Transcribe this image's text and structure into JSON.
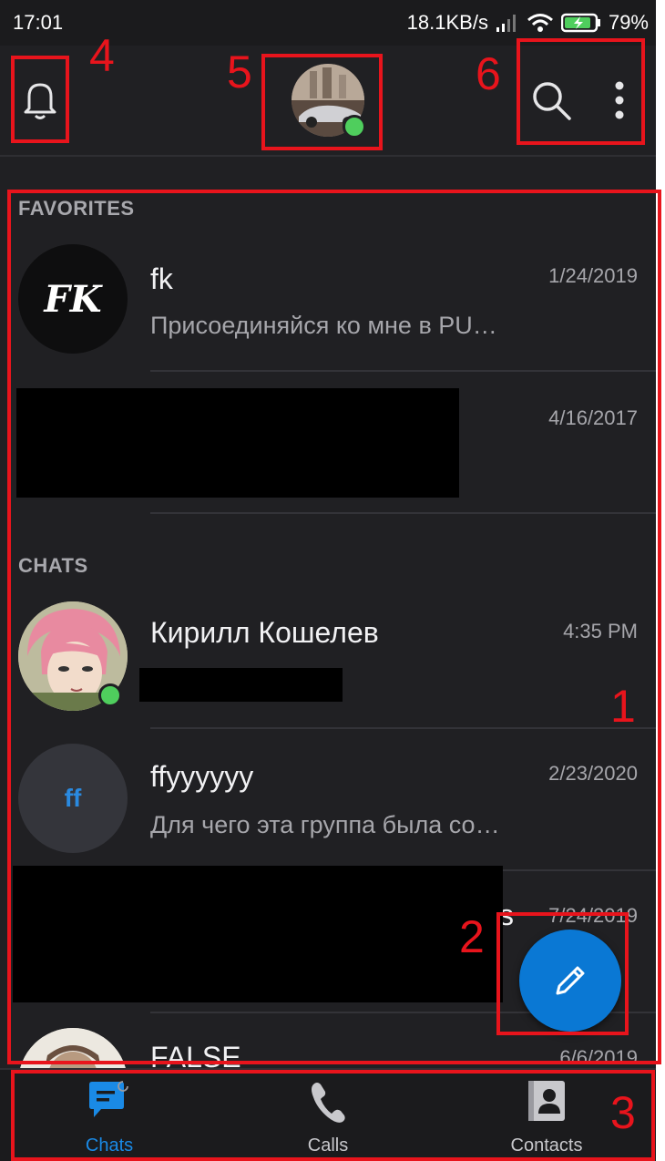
{
  "status_bar": {
    "time": "17:01",
    "net_speed": "18.1KB/s",
    "battery_pct": "79%"
  },
  "app_bar": {
    "notifications_icon": "bell-icon",
    "search_icon": "search-icon",
    "menu_icon": "more-vertical-icon"
  },
  "sections": {
    "favorites": "FAVORITES",
    "chats": "CHATS"
  },
  "favorites": [
    {
      "avatar_text": "FK",
      "name": "fk",
      "preview": "Присоединяйся ко мне в PU…",
      "date": "1/24/2019"
    },
    {
      "name": "",
      "preview": "",
      "date": "4/16/2017"
    }
  ],
  "chats": [
    {
      "name": "Кирилл Кошелев",
      "preview": "",
      "date": "4:35 PM",
      "online": true
    },
    {
      "avatar_text": "ff",
      "name": "ffyyyyyy",
      "preview": "Для чего эта группа была со…",
      "date": "2/23/2020"
    },
    {
      "name": "",
      "name_tail": "s",
      "preview": "",
      "date": "7/24/2019"
    },
    {
      "name": "FALSE",
      "preview": "",
      "date": "6/6/2019"
    }
  ],
  "bottom_nav": [
    {
      "label": "Chats",
      "icon": "chat-icon",
      "active": true
    },
    {
      "label": "Calls",
      "icon": "phone-icon",
      "active": false
    },
    {
      "label": "Contacts",
      "icon": "contacts-icon",
      "active": false
    }
  ],
  "annotations": [
    "1",
    "2",
    "3",
    "4",
    "5",
    "6"
  ],
  "colors": {
    "accent": "#0a78d4",
    "online": "#4fce5d",
    "annotation": "#e8141c",
    "background": "#202023"
  }
}
